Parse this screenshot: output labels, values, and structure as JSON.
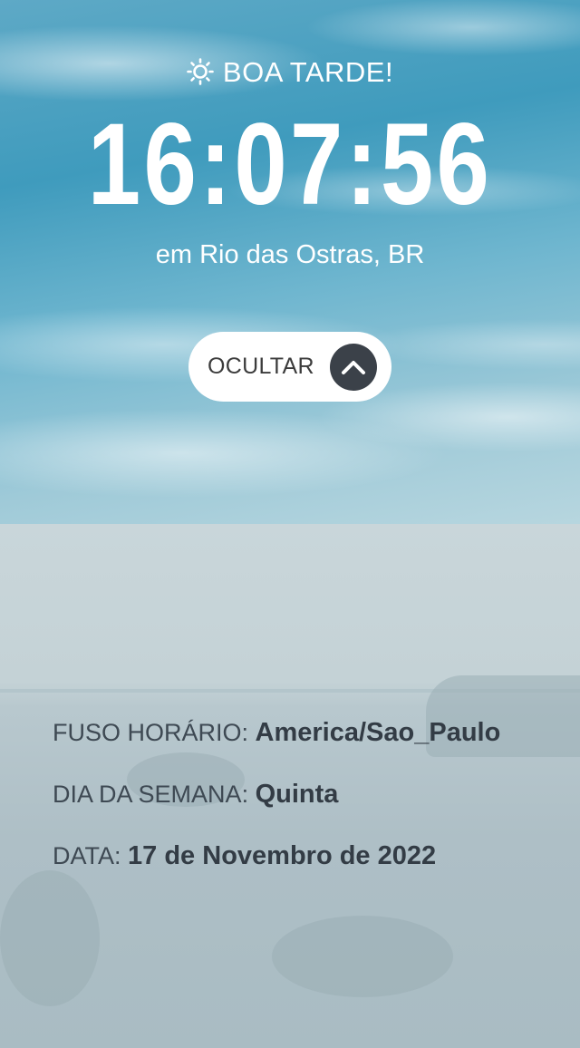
{
  "greeting": {
    "icon": "sun-icon",
    "text": "BOA TARDE!"
  },
  "clock": {
    "time": "16:07:56"
  },
  "location": {
    "text": "em Rio das Ostras, BR"
  },
  "toggle": {
    "label": "OCULTAR",
    "icon": "chevron-up-icon"
  },
  "details": {
    "timezone_label": "FUSO HORÁRIO:",
    "timezone_value": "America/Sao_Paulo",
    "weekday_label": "DIA DA SEMANA:",
    "weekday_value": "Quinta",
    "date_label": "DATA:",
    "date_value": "17 de Novembro de 2022"
  },
  "colors": {
    "text_light": "#ffffff",
    "text_dark": "#333c45",
    "button_bg": "#ffffff",
    "chevron_bg": "#3b4149"
  }
}
